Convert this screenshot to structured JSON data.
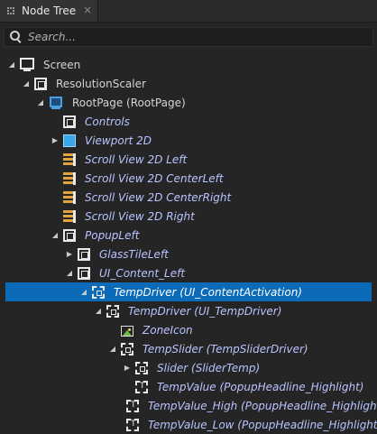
{
  "tab": {
    "title": "Node Tree",
    "close": "×"
  },
  "search": {
    "placeholder": "Search..."
  },
  "tree": [
    {
      "label": "Screen",
      "level": 0,
      "expander": "◢",
      "icon": "screen-icon",
      "italic": false
    },
    {
      "label": "ResolutionScaler",
      "level": 1,
      "expander": "◢",
      "icon": "node-icon",
      "italic": false
    },
    {
      "label": "RootPage (RootPage)",
      "level": 2,
      "expander": "◢",
      "icon": "root-page-icon",
      "italic": false
    },
    {
      "label": "Controls",
      "level": 3,
      "expander": "",
      "icon": "node-icon",
      "italic": true
    },
    {
      "label": "Viewport 2D",
      "level": 3,
      "expander": "▶",
      "icon": "viewport-icon",
      "italic": true
    },
    {
      "label": "Scroll View 2D Left",
      "level": 3,
      "expander": "",
      "icon": "scroll-view-icon",
      "italic": true
    },
    {
      "label": "Scroll View 2D CenterLeft",
      "level": 3,
      "expander": "",
      "icon": "scroll-view-icon",
      "italic": true
    },
    {
      "label": "Scroll View 2D CenterRight",
      "level": 3,
      "expander": "",
      "icon": "scroll-view-icon",
      "italic": true
    },
    {
      "label": "Scroll View 2D Right",
      "level": 3,
      "expander": "",
      "icon": "scroll-view-icon",
      "italic": true
    },
    {
      "label": "PopupLeft",
      "level": 3,
      "expander": "◢",
      "icon": "node-icon",
      "italic": true
    },
    {
      "label": "GlassTileLeft",
      "level": 4,
      "expander": "▶",
      "icon": "node-icon",
      "italic": true
    },
    {
      "label": "UI_Content_Left",
      "level": 4,
      "expander": "◢",
      "icon": "node-icon",
      "italic": true
    },
    {
      "label": "TempDriver (UI_ContentActivation)",
      "level": 5,
      "expander": "◢",
      "icon": "prefab-node-icon",
      "italic": true,
      "selected": true
    },
    {
      "label": "TempDriver (UI_TempDriver)",
      "level": 6,
      "expander": "◢",
      "icon": "prefab-node-icon",
      "italic": true
    },
    {
      "label": "ZoneIcon",
      "level": 7,
      "expander": "",
      "icon": "image-icon",
      "italic": true
    },
    {
      "label": "TempSlider (TempSliderDriver)",
      "level": 7,
      "expander": "◢",
      "icon": "prefab-node-icon",
      "italic": true
    },
    {
      "label": "Slider (SliderTemp)",
      "level": 8,
      "expander": "▶",
      "icon": "prefab-node-icon",
      "italic": true
    },
    {
      "label": "TempValue (PopupHeadline_Highlight)",
      "level": 8,
      "expander": "",
      "icon": "text-node-icon",
      "italic": true
    },
    {
      "label": "TempValue_High (PopupHeadline_Highlight)",
      "level": 8,
      "expander": "",
      "icon": "text-node-icon",
      "italic": true
    },
    {
      "label": "TempValue_Low (PopupHeadline_Highlight)",
      "level": 8,
      "expander": "",
      "icon": "text-node-icon",
      "italic": true
    }
  ]
}
